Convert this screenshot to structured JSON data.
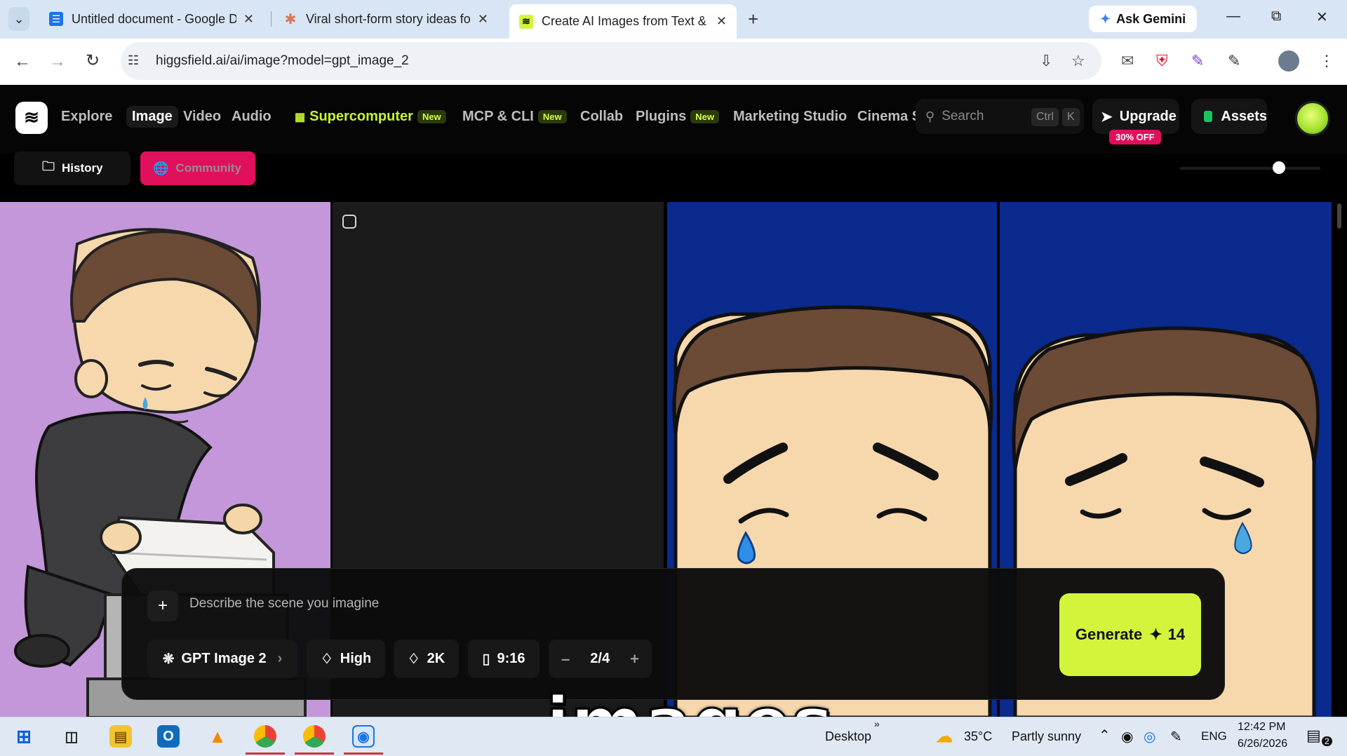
{
  "browser": {
    "tabs": [
      {
        "title": "Untitled document - Google Do",
        "favicon": "docs-icon"
      },
      {
        "title": "Viral short-form story ideas for",
        "favicon": "claude-icon"
      },
      {
        "title": "Create AI Images from Text & P",
        "favicon": "higgsfield-icon"
      }
    ],
    "ask_gemini": "Ask Gemini",
    "url": "higgsfield.ai/ai/image?model=gpt_image_2"
  },
  "app": {
    "nav": {
      "explore": "Explore",
      "image": "Image",
      "video": "Video",
      "audio": "Audio",
      "supercomputer": "Supercomputer",
      "mcp": "MCP & CLI",
      "collab": "Collab",
      "plugins": "Plugins",
      "marketing": "Marketing Studio",
      "cinema": "Cinema S",
      "new_badge": "New"
    },
    "search": {
      "placeholder": "Search",
      "key1": "Ctrl",
      "key2": "K"
    },
    "upgrade": {
      "label": "Upgrade",
      "badge": "30% OFF"
    },
    "assets": "Assets",
    "subtabs": {
      "history": "History",
      "community": "Community"
    },
    "accent": "#d2f53c"
  },
  "prompt": {
    "placeholder": "Describe the scene you imagine",
    "model": "GPT Image 2",
    "quality": "High",
    "resolution": "2K",
    "aspect": "9:16",
    "count": "2/4",
    "generate_label": "Generate",
    "generate_cost": "14"
  },
  "caption": "images",
  "taskbar": {
    "desktop": "Desktop",
    "temp": "35°C",
    "weather": "Partly sunny",
    "lang": "ENG",
    "time": "12:42 PM",
    "date": "6/26/2026",
    "notif": "2"
  }
}
